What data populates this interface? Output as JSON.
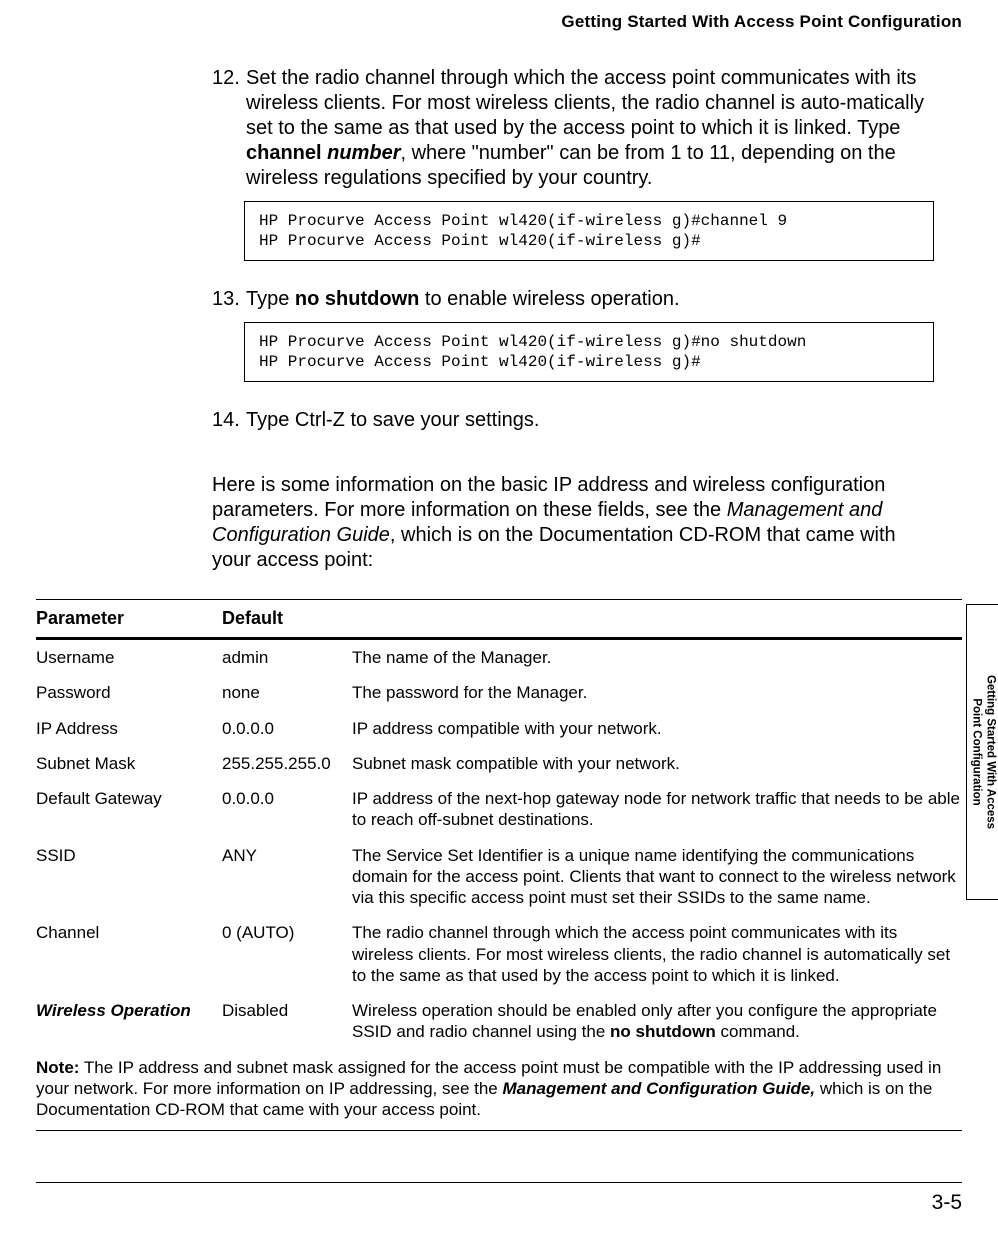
{
  "header": {
    "running_title": "Getting Started With Access Point Configuration"
  },
  "tab": {
    "line1": "Getting Started With Access",
    "line2": "Point Configuration"
  },
  "steps": {
    "s12": {
      "num": "12.",
      "text_a": "Set the radio channel through which the access point communicates with its wireless clients. For most wireless clients, the radio channel is auto-matically set to the same as that used by the access point to which it is linked. Type ",
      "cmd": "channel",
      "arg": "number",
      "text_b": ", where \"number\" can be from 1 to 11, depending on the wireless regulations specified by your country.",
      "code": "HP Procurve Access Point wl420(if-wireless g)#channel 9\nHP Procurve Access Point wl420(if-wireless g)#"
    },
    "s13": {
      "num": "13.",
      "text_a": "Type ",
      "cmd": "no shutdown",
      "text_b": " to enable wireless operation.",
      "code": "HP Procurve Access Point wl420(if-wireless g)#no shutdown\nHP Procurve Access Point wl420(if-wireless g)#"
    },
    "s14": {
      "num": "14.",
      "text": "Type Ctrl-Z to save your settings."
    }
  },
  "intro_para": {
    "a": "Here is some information on the basic IP address and wireless configuration parameters. For more information on these fields, see the ",
    "ital": "Management and Configuration Guide",
    "b": ", which is on the Documentation CD-ROM that came with your access point:"
  },
  "table": {
    "head": {
      "param": "Parameter",
      "def": "Default"
    },
    "rows": [
      {
        "param": "Username",
        "def": "admin",
        "desc": "The name of the Manager.",
        "ital_param": false
      },
      {
        "param": "Password",
        "def": "none",
        "desc": "The password for the Manager.",
        "ital_param": false
      },
      {
        "param": "IP Address",
        "def": "0.0.0.0",
        "desc": "IP address compatible with your network.",
        "ital_param": false
      },
      {
        "param": "Subnet Mask",
        "def": "255.255.255.0",
        "desc": "Subnet mask compatible with your network.",
        "ital_param": false
      },
      {
        "param": "Default Gateway",
        "def": "0.0.0.0",
        "desc": "IP address of the next-hop gateway node for network traffic that needs to be able to reach off-subnet destinations.",
        "ital_param": false
      },
      {
        "param": "SSID",
        "def": "ANY",
        "desc": "The Service Set Identifier is a unique name identifying the communications domain for the access point. Clients that want to connect to the wireless network via this specific access point must set their SSIDs to the same name.",
        "ital_param": false
      },
      {
        "param": "Channel",
        "def": "0 (AUTO)",
        "desc": "The radio channel through which the access point communicates with its wireless clients. For most wireless clients, the radio channel is automatically set to the same as that used by the access point to which it is linked.",
        "ital_param": false
      },
      {
        "param": "Wireless Operation",
        "def": "Disabled",
        "desc_a": "Wireless operation should be enabled only after you configure the appropriate SSID and radio channel using the ",
        "cmd": "no shutdown",
        "desc_b": " command.",
        "ital_param": true
      }
    ],
    "note": {
      "label": "Note:",
      "a": " The IP address and subnet mask assigned for the access point must be compatible with the IP addressing used in your network. For more information on IP addressing, see the ",
      "ital": "Management and Configuration Guide,",
      "b": " which is on the Documentation CD-ROM that came with your access point."
    }
  },
  "footer": {
    "page": "3-5"
  }
}
